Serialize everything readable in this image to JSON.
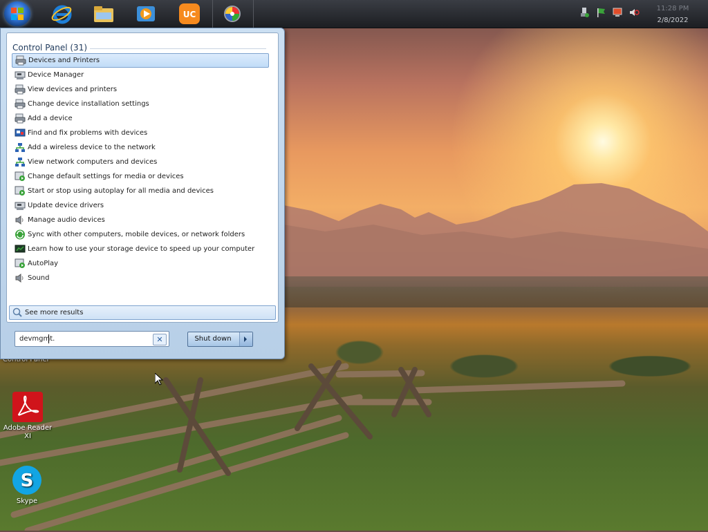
{
  "taskbar": {
    "apps": [
      {
        "name": "internet-explorer-icon"
      },
      {
        "name": "file-explorer-icon"
      },
      {
        "name": "media-player-icon"
      },
      {
        "name": "uc-browser-icon"
      },
      {
        "name": "media-center-icon"
      }
    ],
    "tray": [
      "usb-safely-remove-icon",
      "action-center-flag-icon",
      "network-icon",
      "volume-icon"
    ],
    "clock": {
      "time": "11:28 PM",
      "date": "2/8/2022"
    }
  },
  "start_menu": {
    "group_header": "Control Panel (31)",
    "items": [
      {
        "label": "Devices and Printers",
        "icon": "devices-printers-icon",
        "selected": true
      },
      {
        "label": "Device Manager",
        "icon": "device-manager-icon"
      },
      {
        "label": "View devices and printers",
        "icon": "devices-printers-icon"
      },
      {
        "label": "Change device installation settings",
        "icon": "devices-printers-icon"
      },
      {
        "label": "Add a device",
        "icon": "devices-printers-icon"
      },
      {
        "label": "Find and fix problems with devices",
        "icon": "troubleshoot-icon"
      },
      {
        "label": "Add a wireless device to the network",
        "icon": "network-icon"
      },
      {
        "label": "View network computers and devices",
        "icon": "network-icon"
      },
      {
        "label": "Change default settings for media or devices",
        "icon": "autoplay-icon"
      },
      {
        "label": "Start or stop using autoplay for all media and devices",
        "icon": "autoplay-icon"
      },
      {
        "label": "Update device drivers",
        "icon": "device-manager-icon"
      },
      {
        "label": "Manage audio devices",
        "icon": "speaker-icon"
      },
      {
        "label": "Sync with other computers, mobile devices, or network folders",
        "icon": "sync-center-icon"
      },
      {
        "label": "Learn how to use your storage device to speed up your computer",
        "icon": "readyboost-icon"
      },
      {
        "label": "AutoPlay",
        "icon": "autoplay-icon"
      },
      {
        "label": "Sound",
        "icon": "speaker-icon"
      }
    ],
    "see_more": "See more results",
    "search": {
      "value": "devmgmt."
    },
    "shutdown_label": "Shut down"
  },
  "desktop": {
    "icons": [
      {
        "label": "Control Panel"
      },
      {
        "label": "Adobe Reader XI"
      },
      {
        "label": "Skype"
      }
    ]
  },
  "colors": {
    "taskbar": "#1c1e22",
    "start_menu_bg": "#cbdff2",
    "selection": "#c1dcf7",
    "adobe_red": "#d0141b",
    "skype_blue": "#12a5e4"
  }
}
